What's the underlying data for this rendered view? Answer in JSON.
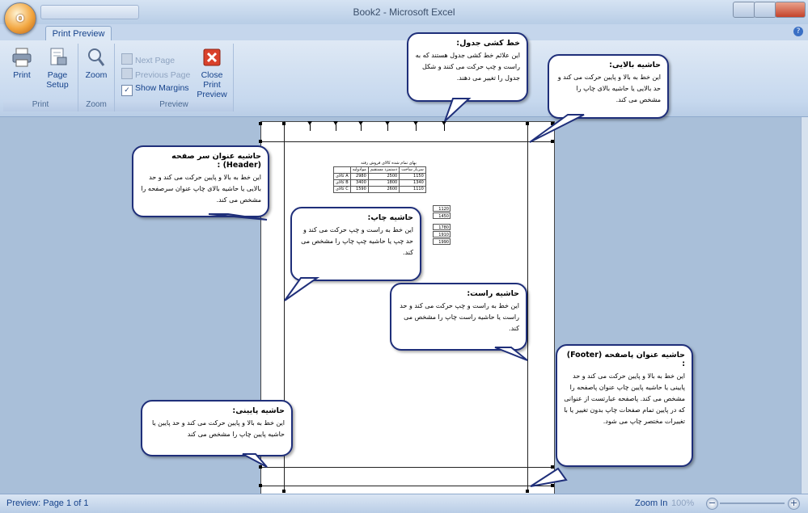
{
  "window": {
    "title": "Book2 - Microsoft Excel"
  },
  "ribbon": {
    "tab": "Print Preview",
    "print_group": {
      "label": "Print",
      "print": "Print",
      "page_setup_1": "Page",
      "page_setup_2": "Setup"
    },
    "zoom_group": {
      "label": "Zoom",
      "zoom": "Zoom"
    },
    "preview_group": {
      "label": "Preview",
      "next_page": "Next Page",
      "previous_page": "Previous Page",
      "show_margins": "Show Margins",
      "close_1": "Close Print",
      "close_2": "Preview"
    }
  },
  "sheet": {
    "title": "بهای تمام شده کالای فروش رفته",
    "headers": [
      "",
      "موادولیه",
      "دستمزد مستقیم",
      "سربار ساخت"
    ],
    "rows": [
      {
        "label": "کالای A",
        "values": [
          "2980",
          "2500",
          "1150"
        ]
      },
      {
        "label": "کالای B",
        "values": [
          "3400",
          "1800",
          "1340"
        ]
      },
      {
        "label": "کالای C",
        "values": [
          "1590",
          "2600",
          "1110"
        ]
      }
    ],
    "extra_values": [
      "1120",
      "1450",
      "1780",
      "1910",
      "1990"
    ]
  },
  "callouts": {
    "table_lines": {
      "title": "خط کشی جدول:",
      "body": "این علائم خط کشی جدول هستند که به راست و چپ حرکت می کنند و شکل جدول را تغییر می دهند."
    },
    "top_margin": {
      "title": "حاشیه بالایی:",
      "body": "این خط به بالا و پایین حرکت می کند و حد بالایی یا حاشیه بالای چاپ را مشخص می کند."
    },
    "header_margin": {
      "title": "حاشیه عنوان سر صفحه (Header) :",
      "body": "این خط به بالا و پایین حرکت می کند و حد بالایی یا حاشیه بالای چاپ عنوان سرصفحه را مشخص می کند."
    },
    "print_margin": {
      "title": "حاشیه چاپ:",
      "body": "این خط به راست و چپ حرکت می کند و حد چپ یا حاشیه چپ چاپ را مشخص می کند."
    },
    "right_margin": {
      "title": "حاشیه راست:",
      "body": "این خط به راست و چپ حرکت می کند و حد راست یا حاشیه راست چاپ را مشخص می کند."
    },
    "footer_margin": {
      "title": "حاشیه عنوان پاصفحه (Footer) :",
      "body": "این خط به بالا و پایین حرکت می کند و حد پایینی یا حاشیه پایین چاپ عنوان پاصفحه را مشخص می کند. پاصفحه عبارتست از عنوانی که در پایین تمام صفحات چاپ بدون تغییر یا با تغییرات مختصر چاپ می شود."
    },
    "bottom_margin": {
      "title": "حاشیه پایینی:",
      "body": "این خط به بالا و پایین حرکت می کند و حد پایین یا حاشیه پایین چاپ را مشخص می کند"
    }
  },
  "status": {
    "text": "Preview: Page 1 of 1",
    "zoom_in": "Zoom In",
    "zoom_pct": "100%"
  },
  "icons": [
    "office-button-icon",
    "print-icon",
    "page-setup-icon",
    "zoom-icon",
    "next-page-icon",
    "previous-page-icon",
    "checkbox-icon",
    "close-preview-icon",
    "minimize-icon",
    "maximize-icon",
    "close-icon",
    "help-icon"
  ]
}
